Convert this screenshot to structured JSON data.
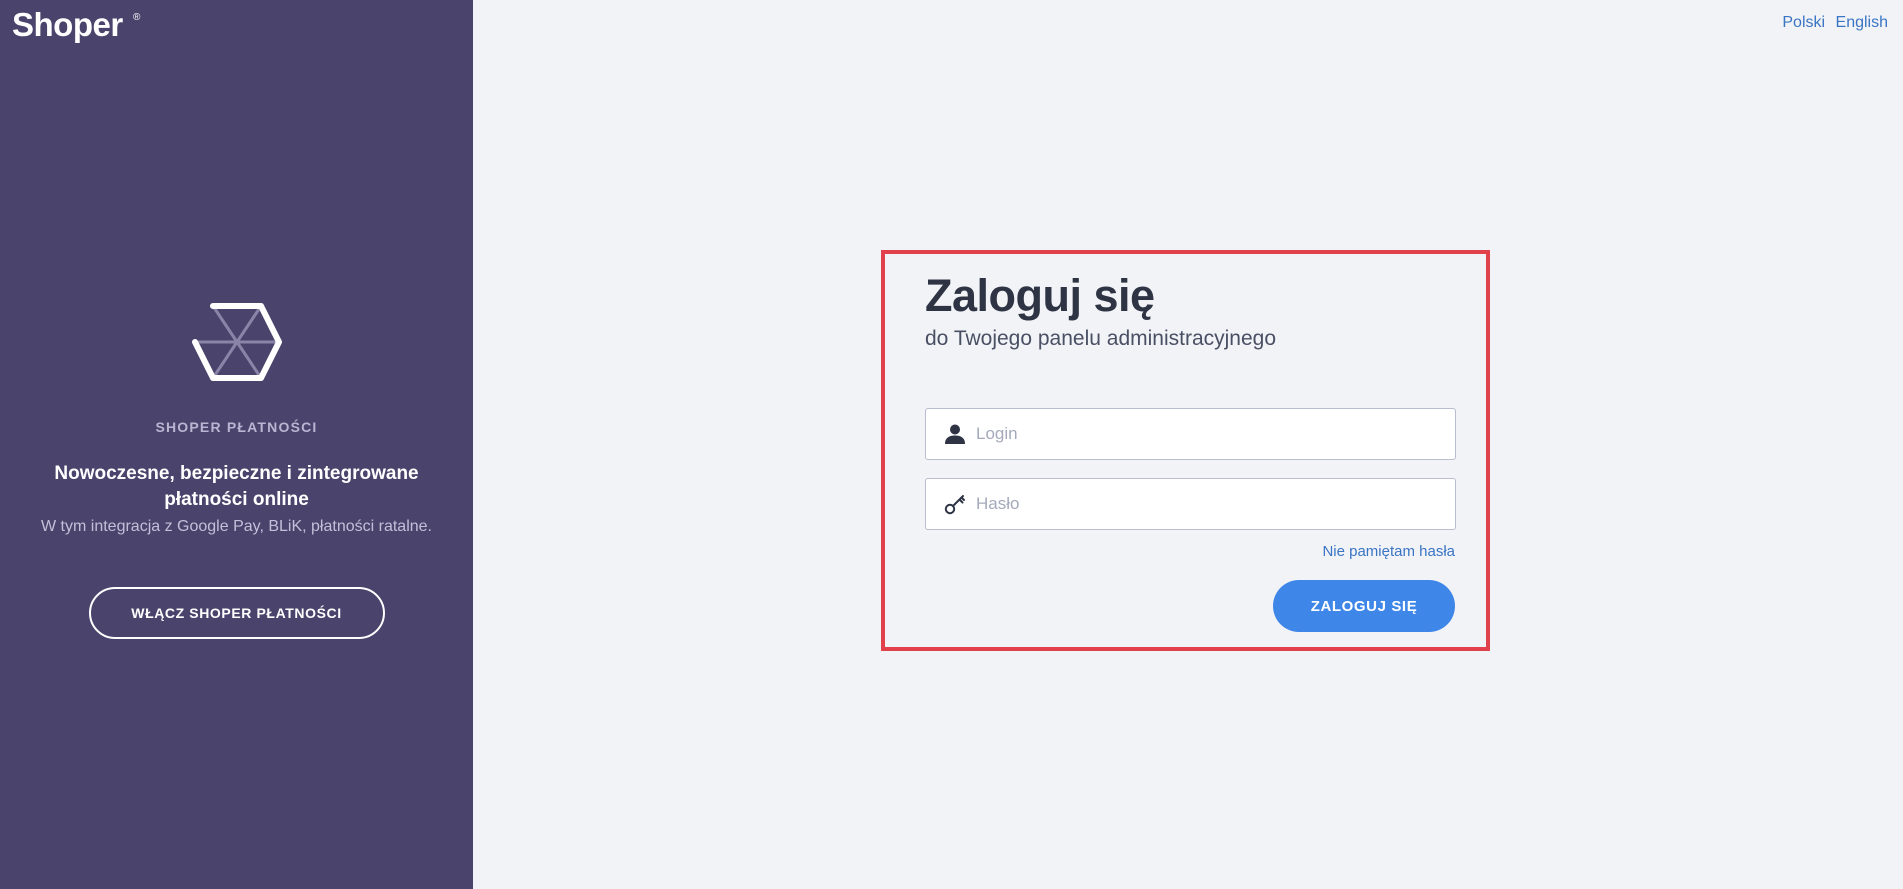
{
  "brand": {
    "name": "Shoper",
    "mark": "®"
  },
  "sidebar": {
    "promo": {
      "eyebrow": "SHOPER PŁATNOŚCI",
      "headline": "Nowoczesne, bezpieczne i zintegrowane płatności online",
      "description": "W tym integracja z Google Pay, BLiK, płatności ratalne.",
      "button_label": "WŁĄCZ SHOPER PŁATNOŚCI"
    }
  },
  "languages": [
    "Polski",
    "English"
  ],
  "login": {
    "title": "Zaloguj się",
    "subtitle": "do Twojego panelu administracyjnego",
    "login_placeholder": "Login",
    "password_placeholder": "Hasło",
    "forgot_label": "Nie pamiętam hasła",
    "submit_label": "ZALOGUJ SIĘ"
  },
  "icons": [
    "user-icon",
    "key-icon",
    "cube-logo-icon"
  ],
  "colors": {
    "sidebar": "#4a446c",
    "page_background": "#f2f3f7",
    "primary_button": "#3e86e8",
    "link": "#3a74c4",
    "highlight_border": "#e0414a"
  }
}
